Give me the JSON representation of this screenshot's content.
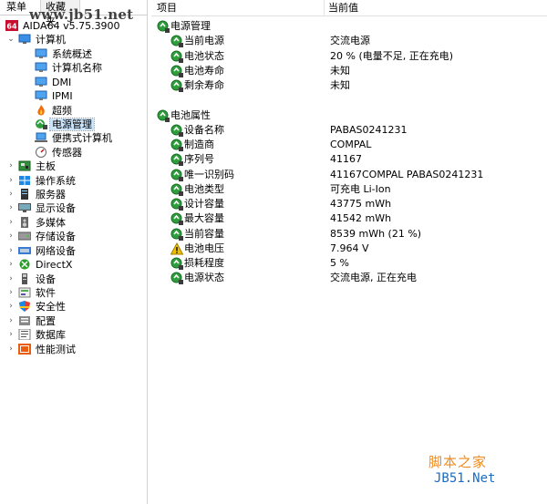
{
  "tabs": {
    "menu": "菜单",
    "favorites": "收藏夹"
  },
  "watermark_top": "www.jb51.net",
  "tree": [
    {
      "label": "AIDA64 v5.75.3900",
      "icon": "aida64-logo-icon",
      "expanded": null
    },
    {
      "label": "计算机",
      "icon": "computer-icon",
      "expanded": true
    },
    {
      "label": "系统概述",
      "icon": "monitor-icon"
    },
    {
      "label": "计算机名称",
      "icon": "monitor-icon"
    },
    {
      "label": "DMI",
      "icon": "monitor-icon"
    },
    {
      "label": "IPMI",
      "icon": "monitor-icon"
    },
    {
      "label": "超频",
      "icon": "flame-icon"
    },
    {
      "label": "电源管理",
      "icon": "power-management-icon",
      "selected": true
    },
    {
      "label": "便携式计算机",
      "icon": "laptop-icon"
    },
    {
      "label": "传感器",
      "icon": "gauge-icon"
    },
    {
      "label": "主板",
      "icon": "motherboard-icon",
      "expanded": false
    },
    {
      "label": "操作系统",
      "icon": "windows-icon",
      "expanded": false
    },
    {
      "label": "服务器",
      "icon": "server-icon",
      "expanded": false
    },
    {
      "label": "显示设备",
      "icon": "display-icon",
      "expanded": false
    },
    {
      "label": "多媒体",
      "icon": "speaker-icon",
      "expanded": false
    },
    {
      "label": "存储设备",
      "icon": "storage-icon",
      "expanded": false
    },
    {
      "label": "网络设备",
      "icon": "network-icon",
      "expanded": false
    },
    {
      "label": "DirectX",
      "icon": "xbox-icon",
      "expanded": false
    },
    {
      "label": "设备",
      "icon": "device-icon",
      "expanded": false
    },
    {
      "label": "软件",
      "icon": "software-icon",
      "expanded": false
    },
    {
      "label": "安全性",
      "icon": "shield-icon",
      "expanded": false
    },
    {
      "label": "配置",
      "icon": "config-icon",
      "expanded": false
    },
    {
      "label": "数据库",
      "icon": "database-icon",
      "expanded": false
    },
    {
      "label": "性能测试",
      "icon": "benchmark-icon",
      "expanded": false
    }
  ],
  "columns": {
    "item": "项目",
    "value": "当前值"
  },
  "rows": [
    {
      "type": "group",
      "name": "电源管理",
      "value": "",
      "icon": "power-icon"
    },
    {
      "type": "item",
      "name": "当前电源",
      "value": "交流电源",
      "icon": "power-icon"
    },
    {
      "type": "item",
      "name": "电池状态",
      "value": "20 % (电量不足, 正在充电)",
      "icon": "power-icon"
    },
    {
      "type": "item",
      "name": "电池寿命",
      "value": "未知",
      "icon": "power-icon"
    },
    {
      "type": "item",
      "name": "剩余寿命",
      "value": "未知",
      "icon": "power-icon"
    },
    {
      "type": "spacer"
    },
    {
      "type": "group",
      "name": "电池属性",
      "value": "",
      "icon": "power-icon"
    },
    {
      "type": "item",
      "name": "设备名称",
      "value": "PABAS0241231",
      "icon": "power-icon"
    },
    {
      "type": "item",
      "name": "制造商",
      "value": "COMPAL",
      "icon": "power-icon"
    },
    {
      "type": "item",
      "name": "序列号",
      "value": "41167",
      "icon": "power-icon"
    },
    {
      "type": "item",
      "name": "唯一识别码",
      "value": "41167COMPAL PABAS0241231",
      "icon": "power-icon"
    },
    {
      "type": "item",
      "name": "电池类型",
      "value": "可充电 Li-Ion",
      "icon": "power-icon"
    },
    {
      "type": "item",
      "name": "设计容量",
      "value": "43775 mWh",
      "icon": "power-icon"
    },
    {
      "type": "item",
      "name": "最大容量",
      "value": "41542 mWh",
      "icon": "power-icon"
    },
    {
      "type": "item",
      "name": "当前容量",
      "value": "8539 mWh  (21 %)",
      "icon": "power-icon"
    },
    {
      "type": "item",
      "name": "电池电压",
      "value": "7.964 V",
      "icon": "warning-icon"
    },
    {
      "type": "item",
      "name": "损耗程度",
      "value": "5 %",
      "icon": "power-icon"
    },
    {
      "type": "item",
      "name": "电源状态",
      "value": "交流电源, 正在充电",
      "icon": "power-icon"
    }
  ],
  "watermark": {
    "cn": "脚本之家",
    "en": "JB51.Net"
  },
  "colors": {
    "selection": "#cde5fb",
    "accent": "#1a6cc0",
    "warning": "#f0c000",
    "watermark_orange": "#f08a19"
  }
}
